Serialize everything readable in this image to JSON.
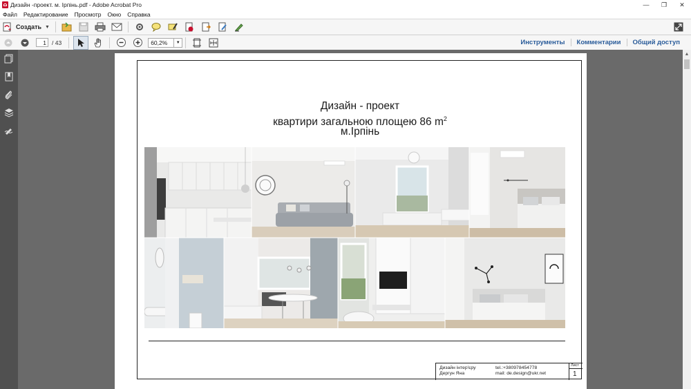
{
  "window": {
    "title": "Дизайн -проект. м. Ірпінь.pdf - Adobe Acrobat Pro",
    "minimize": "—",
    "restore": "❐",
    "close": "✕"
  },
  "menu": [
    "Файл",
    "Редактирование",
    "Просмотр",
    "Окно",
    "Справка"
  ],
  "toolbar": {
    "create_label": "Создать"
  },
  "nav": {
    "current_page": "1",
    "total_pages": "/ 43",
    "zoom": "60,2%"
  },
  "panels": {
    "tools": "Инструменты",
    "comments": "Комментарии",
    "share": "Общий доступ"
  },
  "document": {
    "title_line1": "Дизайн - проект",
    "title_line2": "квартири загальною площею 86 m",
    "title_sup": "2",
    "title_line3": "м.Ірпінь",
    "stamp": {
      "designer_line1": "Дизайн інтер'єру",
      "designer_line2": "Дергун Яна",
      "tel": "tel.:+380978454778",
      "mail": "mail: de.design@ukr.net",
      "sheet_label": "Лист",
      "sheet_number": "1"
    }
  },
  "colors": {
    "sidebar": "#505050",
    "viewer_bg": "#6a6a6a",
    "link": "#2a5c9a",
    "brand": "#c8102e"
  }
}
